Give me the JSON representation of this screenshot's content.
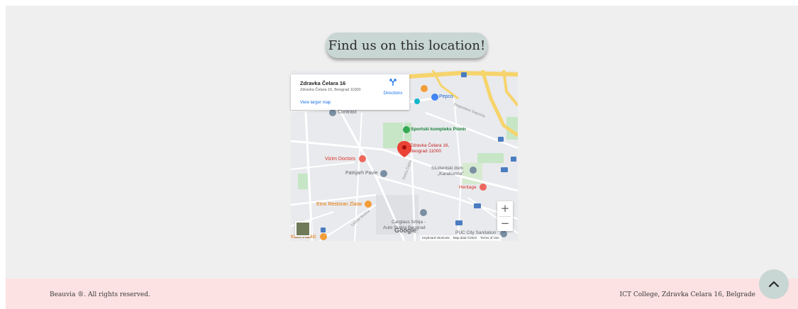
{
  "section": {
    "heading": "Find us on this location!"
  },
  "map": {
    "place_name": "Zdravka Čelara 16",
    "place_address": "Zdravka Čelara 16, Beograd 11000",
    "view_larger_label": "View larger map",
    "directions_label": "Directions",
    "pin_label_line1": "Zdravka Čelara 16,",
    "pin_label_line2": "Beograd 11000",
    "labels": {
      "contrast": "Contrast",
      "sport": "Sportski kompleks Pionir",
      "pepco": "Pepco",
      "vizim": "Vizim Doctors",
      "patrijarh": "Patrijarh Pavle",
      "studentski1": "Studentski dom",
      "studentski2": "„Karaburma\"",
      "heritage": "Heritage",
      "etno": "Etno Restoran Zlatar",
      "carglass1": "Carglass Srbija -",
      "carglass2": "Auto Stakla Beograd",
      "puc": "PUC City Sanitation",
      "kafe": "Kafe Parkić",
      "dragoslava": "Dragoslava Srejovića",
      "ljubice": "Ljubice Ilinčića",
      "street_vert": "Čerča Čajića"
    },
    "google_logo": "Google",
    "attribution": {
      "shortcuts": "Keyboard shortcuts",
      "data": "Map data ©2022",
      "terms": "Terms of Use"
    },
    "zoom_in": "+",
    "zoom_out": "−"
  },
  "footer": {
    "copyright": "Beauvia ®. All rights reserved.",
    "address": "ICT College, Zdravka Celara 16, Belgrade"
  },
  "colors": {
    "accent": "#c8d6d4",
    "footer_bg": "#fce2e2",
    "page_bg": "#efefef",
    "link": "#1a73e8",
    "pin": "#ea4335"
  }
}
